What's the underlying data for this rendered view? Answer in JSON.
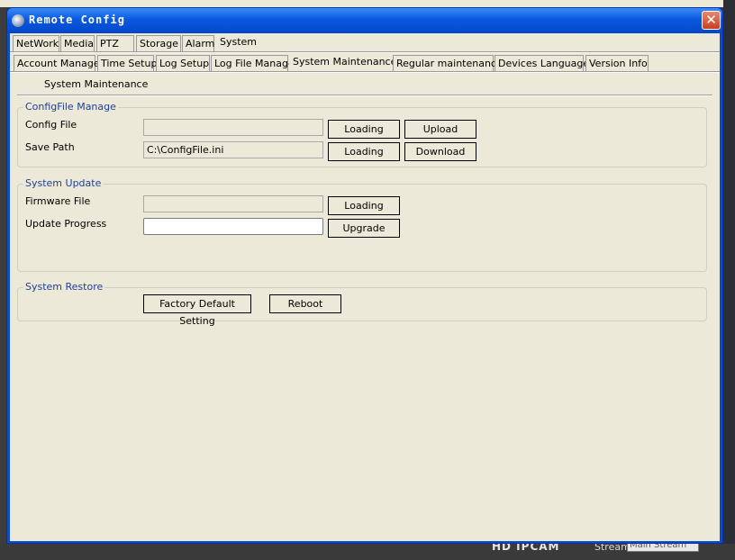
{
  "window": {
    "title": "Remote Config",
    "close_label": "✕"
  },
  "tabs_top": [
    {
      "label": "NetWork"
    },
    {
      "label": "Media"
    },
    {
      "label": "PTZ"
    },
    {
      "label": "Storage"
    },
    {
      "label": "Alarm"
    },
    {
      "label": "System"
    }
  ],
  "tabs_sub": [
    {
      "label": "Account Manage"
    },
    {
      "label": "Time Setup"
    },
    {
      "label": "Log Setup"
    },
    {
      "label": "Log File Manage"
    },
    {
      "label": "System Maintenance"
    },
    {
      "label": "Regular maintenance"
    },
    {
      "label": "Devices Language"
    },
    {
      "label": "Version Info"
    }
  ],
  "panel": {
    "title": "System Maintenance"
  },
  "configfile": {
    "legend": "ConfigFile Manage",
    "config_file_label": "Config File",
    "config_file_value": "",
    "save_path_label": "Save Path",
    "save_path_value": "C:\\ConfigFile.ini",
    "loading1": "Loading",
    "upload": "Upload",
    "loading2": "Loading",
    "download": "Download"
  },
  "update": {
    "legend": "System Update",
    "firmware_label": "Firmware File",
    "firmware_value": "",
    "progress_label": "Update Progress",
    "progress_value": 0,
    "loading": "Loading",
    "upgrade": "Upgrade"
  },
  "restore": {
    "legend": "System Restore",
    "factory_default": "Factory Default Setting",
    "reboot": "Reboot"
  },
  "background": {
    "banner": "HD IPCAM",
    "stream_label": "Stream",
    "stream_value": "Main Stream"
  },
  "colors": {
    "titlebar": "#0a58e0",
    "client": "#ece9d8",
    "legend": "#1f3f9a",
    "close": "#c7401f"
  }
}
